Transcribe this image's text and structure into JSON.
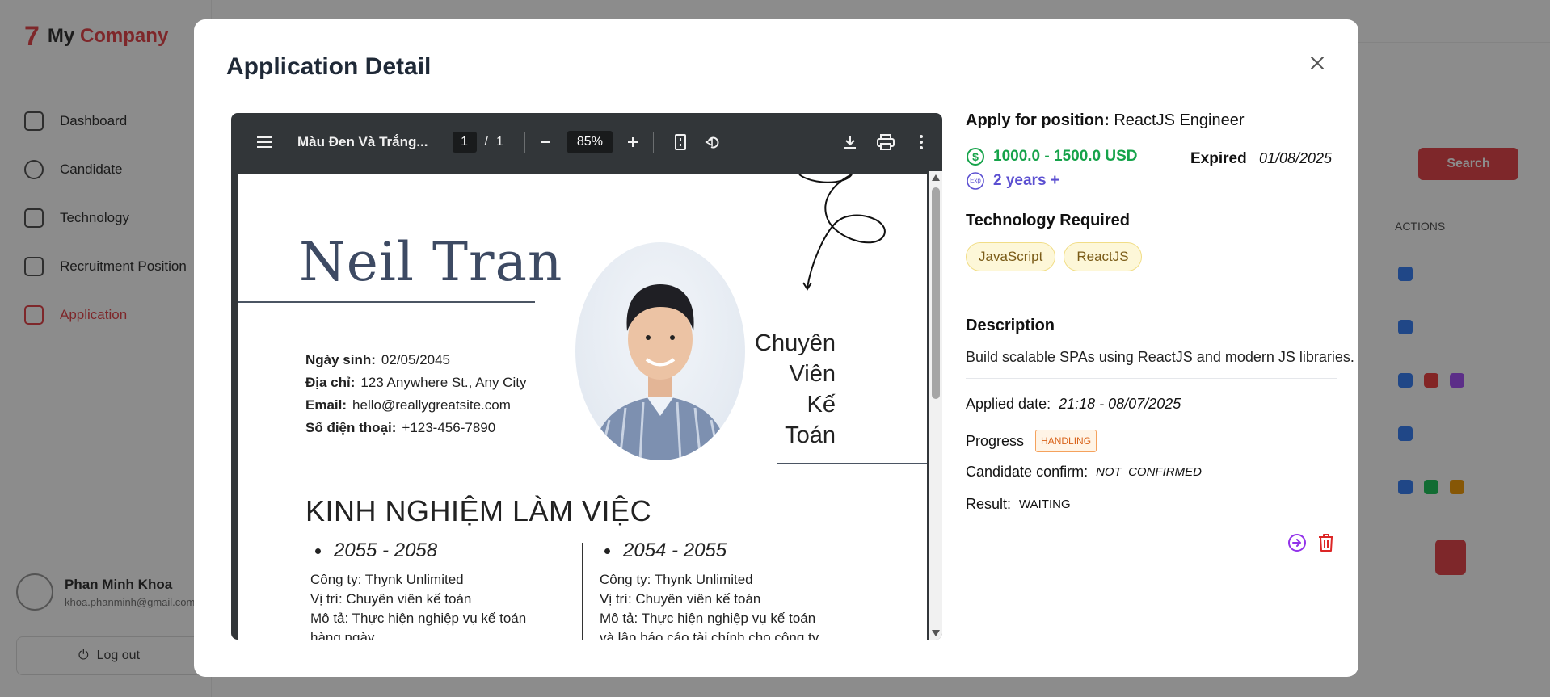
{
  "background": {
    "logo": {
      "mark": "7",
      "text_my": "My",
      "text_company": "Company"
    },
    "menu": [
      {
        "label": "Dashboard"
      },
      {
        "label": "Candidate"
      },
      {
        "label": "Technology"
      },
      {
        "label": "Recruitment Position"
      },
      {
        "label": "Application"
      }
    ],
    "user": {
      "name": "Phan Minh Khoa",
      "email": "khoa.phanminh@gmail.com"
    },
    "logout_label": "Log out",
    "search_button": "Search",
    "actions_header": "ACTIONS",
    "accent": "#e5484d"
  },
  "modal": {
    "title": "Application Detail",
    "close_icon": "close-icon"
  },
  "pdf_viewer": {
    "file_name": "Màu Đen Và Trắng...",
    "current_page": "1",
    "page_separator": "/",
    "total_pages": "1",
    "zoom": "85%",
    "resume": {
      "name": "Neil Tran",
      "info": [
        {
          "label": "Ngày sinh:",
          "value": "02/05/2045"
        },
        {
          "label": "Địa chỉ:",
          "value": "123 Anywhere St., Any City"
        },
        {
          "label": "Email:",
          "value": "hello@reallygreatsite.com"
        },
        {
          "label": "Số điện thoại:",
          "value": "+123-456-7890"
        }
      ],
      "role_lines": [
        "Chuyên",
        "Viên",
        "Kế",
        "Toán"
      ],
      "section_title": "KINH NGHIỆM LÀM VIỆC",
      "experience": [
        {
          "years": "2055 - 2058",
          "lines": [
            "Công ty: Thynk Unlimited",
            "Vị trí: Chuyên viên kế toán",
            "Mô tả: Thực hiện nghiệp vụ kế toán",
            "hàng ngày."
          ]
        },
        {
          "years": "2054 - 2055",
          "lines": [
            "Công ty: Thynk Unlimited",
            "Vị trí: Chuyên viên kế toán",
            "Mô tả: Thực hiện nghiệp vụ kế toán",
            "và lập báo cáo tài chính cho công ty"
          ]
        }
      ]
    }
  },
  "details": {
    "apply_label": "Apply for position:",
    "position": "ReactJS Engineer",
    "salary": "1000.0 - 1500.0 USD",
    "experience_icon_text": "Exp",
    "experience": "2 years +",
    "expired_label": "Expired",
    "expired_date": "01/08/2025",
    "tech_title": "Technology Required",
    "technologies": [
      "JavaScript",
      "ReactJS"
    ],
    "description_title": "Description",
    "description": "Build scalable SPAs using ReactJS and modern JS libraries.",
    "applied_label": "Applied date:",
    "applied_value": "21:18 - 08/07/2025",
    "progress_label": "Progress",
    "progress_value": "HANDLING",
    "confirm_label": "Candidate confirm:",
    "confirm_value": "NOT_CONFIRMED",
    "result_label": "Result:",
    "result_value": "WAITING",
    "colors": {
      "salary": "#16a34a",
      "experience": "#5b4fd1",
      "delete": "#dc2626",
      "proceed": "#9333ea"
    }
  }
}
